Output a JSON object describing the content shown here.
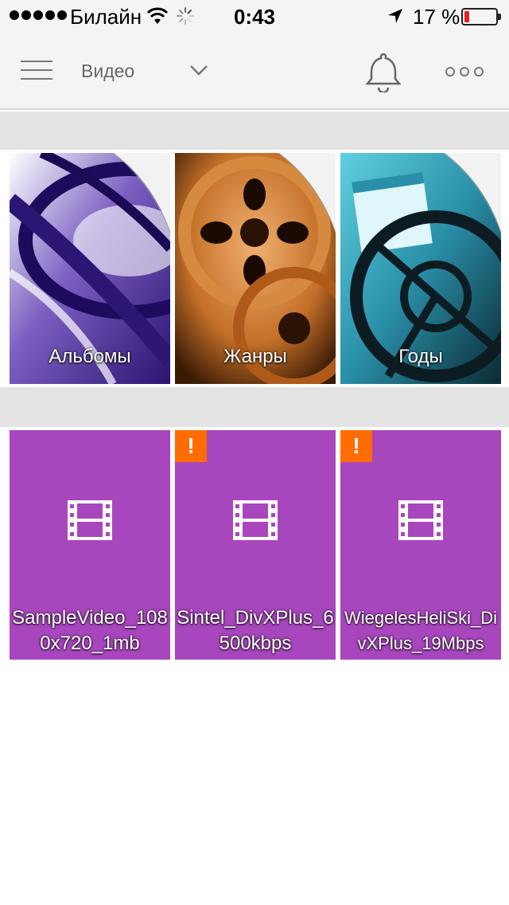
{
  "status_bar": {
    "carrier": "Билайн",
    "time": "0:43",
    "battery_percent": "17 %",
    "battery_level": 0.17,
    "signal_bars": 5,
    "icons": [
      "signal-icon",
      "wifi-icon",
      "activity-icon",
      "location-icon",
      "battery-icon"
    ]
  },
  "header": {
    "title": "Видео",
    "icons": [
      "menu-icon",
      "chevron-down-icon",
      "bell-icon",
      "more-icon"
    ]
  },
  "categories": [
    {
      "label": "Альбомы"
    },
    {
      "label": "Жанры"
    },
    {
      "label": "Годы"
    }
  ],
  "videos": [
    {
      "name": "SampleVideo_1080x720_1mb",
      "warning": false
    },
    {
      "name": "Sintel_DivXPlus_6500kbps",
      "warning": true,
      "badge": "!"
    },
    {
      "name": "WiegelesHeliSki_DivXPlus_19Mbps",
      "warning": true,
      "badge": "!"
    }
  ],
  "colors": {
    "video_tile": "#a846be",
    "warning_badge": "#ff6c00",
    "battery_low": "#e8201c",
    "header_bg": "#f4f4f4",
    "section_bar": "#e4e4e4"
  }
}
